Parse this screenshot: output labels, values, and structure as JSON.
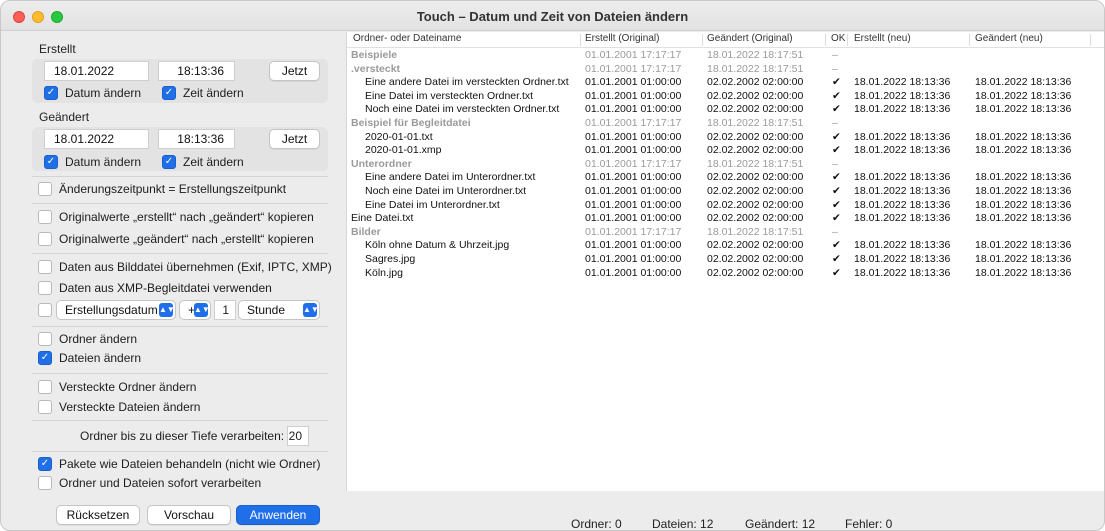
{
  "window": {
    "title": "Touch – Datum und Zeit von Dateien ändern"
  },
  "created": {
    "title": "Erstellt",
    "date": "18.01.2022",
    "time": "18:13:36",
    "now_label": "Jetzt",
    "change_date_label": "Datum ändern",
    "change_date_checked": true,
    "change_time_label": "Zeit ändern",
    "change_time_checked": true
  },
  "modified": {
    "title": "Geändert",
    "date": "18.01.2022",
    "time": "18:13:36",
    "now_label": "Jetzt",
    "change_date_label": "Datum ändern",
    "change_date_checked": true,
    "change_time_label": "Zeit ändern",
    "change_time_checked": true
  },
  "options": {
    "mod_eq_created": "Änderungszeitpunkt = Erstellungszeitpunkt",
    "copy_created_to_modified": "Originalwerte „erstellt“ nach „geändert“ kopieren",
    "copy_modified_to_created": "Originalwerte „geändert“ nach „erstellt“ kopieren",
    "from_image": "Daten aus Bilddatei übernehmen (Exif, IPTC, XMP)",
    "from_xmp": "Daten aus XMP-Begleitdatei verwenden",
    "offset_field": "Erstellungsdatum",
    "offset_sign": "+",
    "offset_value": "1",
    "offset_unit": "Stunde",
    "change_folders": "Ordner ändern",
    "change_files": "Dateien ändern",
    "hidden_folders": "Versteckte Ordner ändern",
    "hidden_files": "Versteckte Dateien ändern",
    "depth_label": "Ordner bis zu dieser Tiefe verarbeiten:",
    "depth_value": "20",
    "packages_as_files": "Pakete wie Dateien behandeln (nicht wie Ordner)",
    "process_immediately": "Ordner und Dateien sofort verarbeiten"
  },
  "buttons": {
    "reset": "Rücksetzen",
    "preview": "Vorschau",
    "apply": "Anwenden"
  },
  "table": {
    "headers": [
      "Ordner- oder Dateiname",
      "Erstellt (Original)",
      "Geändert (Original)",
      "OK",
      "Erstellt (neu)",
      "Geändert (neu)"
    ],
    "rows": [
      {
        "type": "folder",
        "indent": 0,
        "name": "Beispiele",
        "c1": "01.01.2001  17:17:17",
        "c2": "18.01.2022  18:17:51",
        "ok": "–",
        "c3": "",
        "c4": ""
      },
      {
        "type": "folder",
        "indent": 0,
        "name": ".versteckt",
        "c1": "01.01.2001  17:17:17",
        "c2": "18.01.2022  18:17:51",
        "ok": "–",
        "c3": "",
        "c4": ""
      },
      {
        "type": "file",
        "indent": 1,
        "name": "Eine andere Datei im versteckten Ordner.txt",
        "c1": "01.01.2001  01:00:00",
        "c2": "02.02.2002  02:00:00",
        "ok": "✔",
        "c3": "18.01.2022  18:13:36",
        "c4": "18.01.2022  18:13:36"
      },
      {
        "type": "file",
        "indent": 1,
        "name": "Eine Datei im versteckten Ordner.txt",
        "c1": "01.01.2001  01:00:00",
        "c2": "02.02.2002  02:00:00",
        "ok": "✔",
        "c3": "18.01.2022  18:13:36",
        "c4": "18.01.2022  18:13:36"
      },
      {
        "type": "file",
        "indent": 1,
        "name": "Noch eine Datei im versteckten Ordner.txt",
        "c1": "01.01.2001  01:00:00",
        "c2": "02.02.2002  02:00:00",
        "ok": "✔",
        "c3": "18.01.2022  18:13:36",
        "c4": "18.01.2022  18:13:36"
      },
      {
        "type": "folder",
        "indent": 0,
        "name": "Beispiel für Begleitdatei",
        "c1": "01.01.2001  17:17:17",
        "c2": "18.01.2022  18:17:51",
        "ok": "–",
        "c3": "",
        "c4": ""
      },
      {
        "type": "file",
        "indent": 1,
        "name": "2020-01-01.txt",
        "c1": "01.01.2001  01:00:00",
        "c2": "02.02.2002  02:00:00",
        "ok": "✔",
        "c3": "18.01.2022  18:13:36",
        "c4": "18.01.2022  18:13:36"
      },
      {
        "type": "file",
        "indent": 1,
        "name": "2020-01-01.xmp",
        "c1": "01.01.2001  01:00:00",
        "c2": "02.02.2002  02:00:00",
        "ok": "✔",
        "c3": "18.01.2022  18:13:36",
        "c4": "18.01.2022  18:13:36"
      },
      {
        "type": "folder",
        "indent": 0,
        "name": "Unterordner",
        "c1": "01.01.2001  17:17:17",
        "c2": "18.01.2022  18:17:51",
        "ok": "–",
        "c3": "",
        "c4": ""
      },
      {
        "type": "file",
        "indent": 1,
        "name": "Eine andere Datei im Unterordner.txt",
        "c1": "01.01.2001  01:00:00",
        "c2": "02.02.2002  02:00:00",
        "ok": "✔",
        "c3": "18.01.2022  18:13:36",
        "c4": "18.01.2022  18:13:36"
      },
      {
        "type": "file",
        "indent": 1,
        "name": "Noch eine Datei im Unterordner.txt",
        "c1": "01.01.2001  01:00:00",
        "c2": "02.02.2002  02:00:00",
        "ok": "✔",
        "c3": "18.01.2022  18:13:36",
        "c4": "18.01.2022  18:13:36"
      },
      {
        "type": "file",
        "indent": 1,
        "name": "Eine Datei im Unterordner.txt",
        "c1": "01.01.2001  01:00:00",
        "c2": "02.02.2002  02:00:00",
        "ok": "✔",
        "c3": "18.01.2022  18:13:36",
        "c4": "18.01.2022  18:13:36"
      },
      {
        "type": "file",
        "indent": 0,
        "name": "Eine Datei.txt",
        "c1": "01.01.2001  01:00:00",
        "c2": "02.02.2002  02:00:00",
        "ok": "✔",
        "c3": "18.01.2022  18:13:36",
        "c4": "18.01.2022  18:13:36"
      },
      {
        "type": "folder",
        "indent": 0,
        "name": "Bilder",
        "c1": "01.01.2001  17:17:17",
        "c2": "18.01.2022  18:17:51",
        "ok": "–",
        "c3": "",
        "c4": ""
      },
      {
        "type": "file",
        "indent": 1,
        "name": "Köln ohne Datum & Uhrzeit.jpg",
        "c1": "01.01.2001  01:00:00",
        "c2": "02.02.2002  02:00:00",
        "ok": "✔",
        "c3": "18.01.2022  18:13:36",
        "c4": "18.01.2022  18:13:36"
      },
      {
        "type": "file",
        "indent": 1,
        "name": "Sagres.jpg",
        "c1": "01.01.2001  01:00:00",
        "c2": "02.02.2002  02:00:00",
        "ok": "✔",
        "c3": "18.01.2022  18:13:36",
        "c4": "18.01.2022  18:13:36"
      },
      {
        "type": "file",
        "indent": 1,
        "name": "Köln.jpg",
        "c1": "01.01.2001  01:00:00",
        "c2": "02.02.2002  02:00:00",
        "ok": "✔",
        "c3": "18.01.2022  18:13:36",
        "c4": "18.01.2022  18:13:36"
      }
    ]
  },
  "status": {
    "folders": "Ordner: 0",
    "files": "Dateien: 12",
    "changed": "Geändert: 12",
    "errors": "Fehler: 0"
  },
  "colors": {
    "accent": "#1f6fe9",
    "folder_text": "#9a9a9a"
  }
}
